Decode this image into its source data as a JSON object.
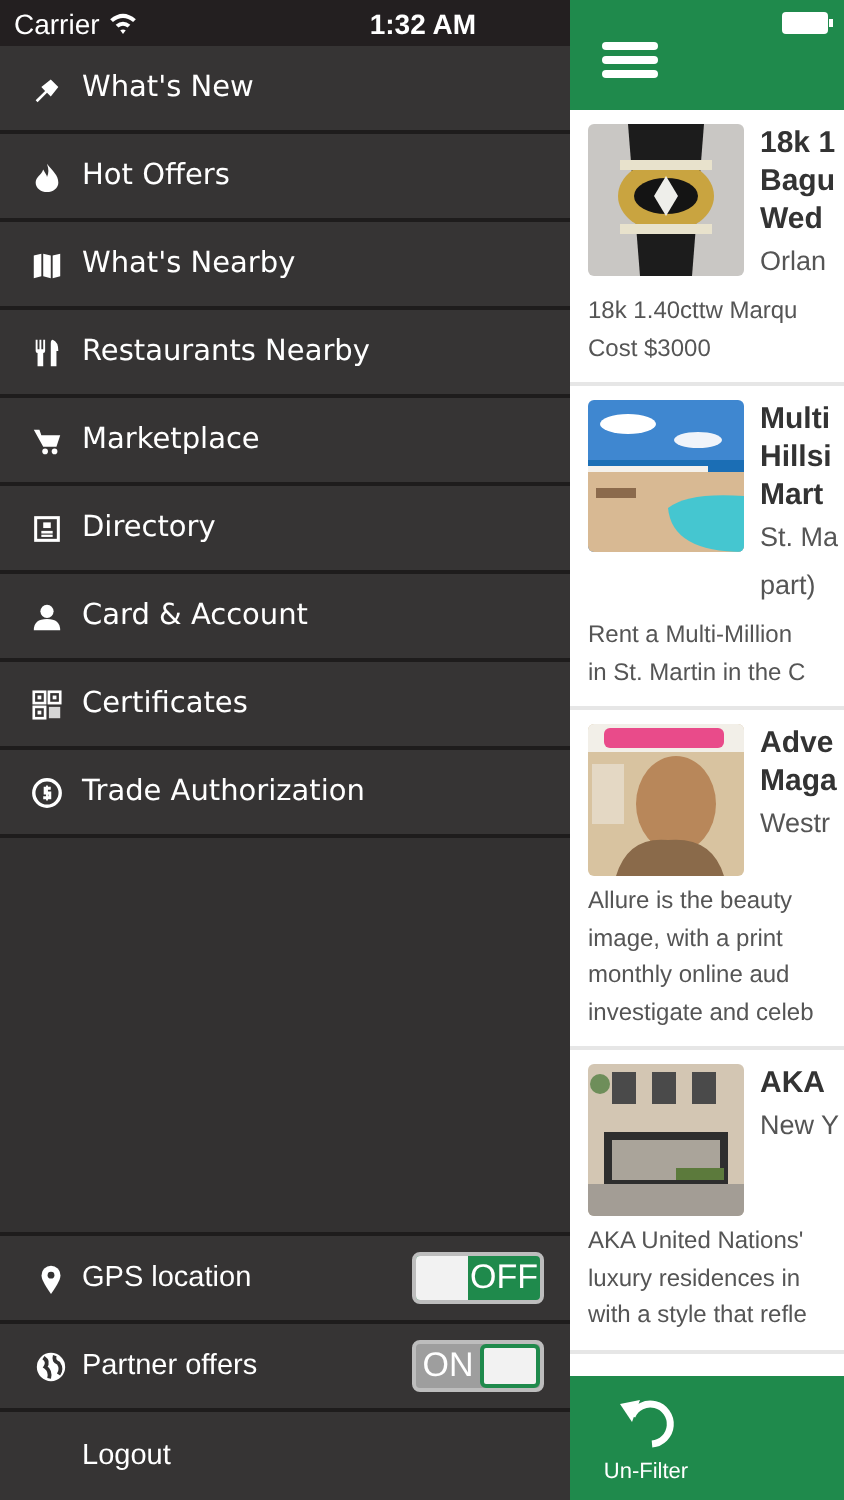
{
  "status_bar": {
    "carrier": "Carrier",
    "time": "1:32 AM"
  },
  "menu": [
    {
      "label": "What's New"
    },
    {
      "label": "Hot Offers"
    },
    {
      "label": "What's Nearby"
    },
    {
      "label": "Restaurants Nearby"
    },
    {
      "label": "Marketplace"
    },
    {
      "label": "Directory"
    },
    {
      "label": "Card & Account"
    },
    {
      "label": "Certificates"
    },
    {
      "label": "Trade Authorization"
    }
  ],
  "settings": [
    {
      "label": "GPS location",
      "on": false,
      "switch_text": "OFF"
    },
    {
      "label": "Partner offers",
      "on": true,
      "switch_text": "ON"
    }
  ],
  "logout": "Logout",
  "listings": [
    {
      "title": [
        "18k 1",
        "Bagu",
        "Wed"
      ],
      "location": [
        "Orlan"
      ],
      "description": [
        "18k  1.40cttw  Marqu",
        "Cost $3000"
      ]
    },
    {
      "title": [
        "Multi",
        "Hillsi",
        "Mart"
      ],
      "location": [
        "St. Ma",
        "part)"
      ],
      "description": [
        "Rent a Multi-Million",
        "in St. Martin in the C"
      ]
    },
    {
      "title": [
        "Adve",
        "Maga"
      ],
      "location": [
        "Westr"
      ],
      "description": [
        "Allure is the beauty",
        "image,  with  a  print",
        "monthly  online  aud",
        "investigate and celeb"
      ]
    },
    {
      "title": [
        "AKA"
      ],
      "location": [
        "New Y"
      ],
      "description": [
        "AKA United Nations'",
        "luxury residences in",
        "with a style that refle"
      ]
    }
  ],
  "tab_bar": [
    {
      "label": "Un-Filter"
    }
  ]
}
